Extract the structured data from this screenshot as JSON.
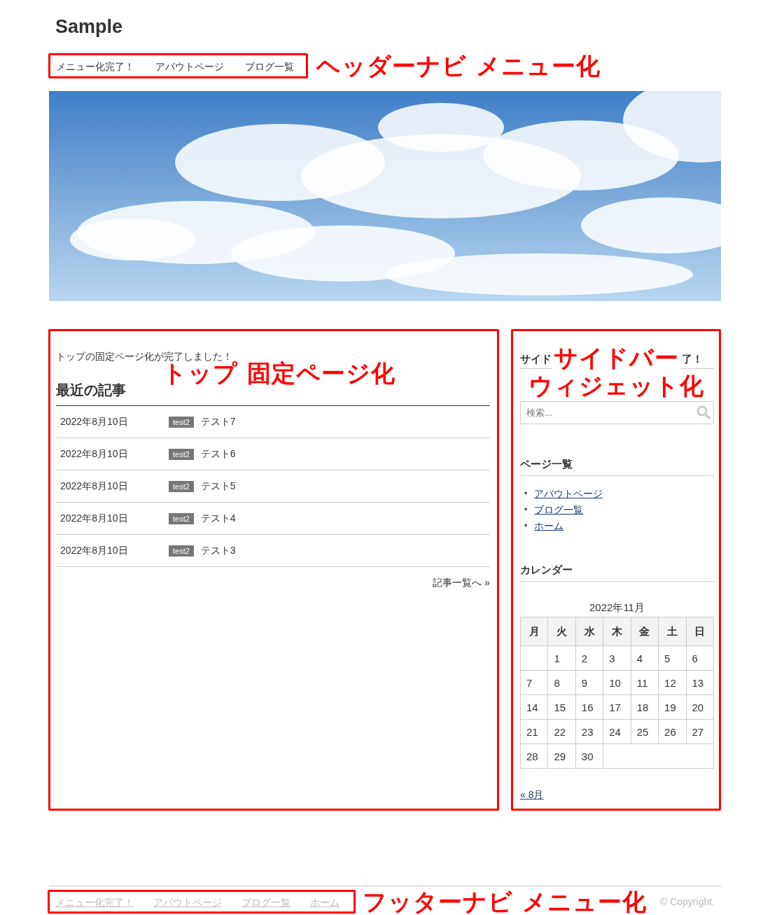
{
  "site_title": "Sample",
  "header_nav": {
    "items": [
      "メニュー化完了！",
      "アバウトページ",
      "ブログ一覧"
    ],
    "annotation": "ヘッダーナビ メニュー化"
  },
  "main": {
    "intro": "トップの固定ページ化が完了しました！",
    "annotation": "トップ 固定ページ化",
    "heading": "最近の記事",
    "posts": [
      {
        "date": "2022年8月10日",
        "tag": "test2",
        "title": "テスト7"
      },
      {
        "date": "2022年8月10日",
        "tag": "test2",
        "title": "テスト6"
      },
      {
        "date": "2022年8月10日",
        "tag": "test2",
        "title": "テスト5"
      },
      {
        "date": "2022年8月10日",
        "tag": "test2",
        "title": "テスト4"
      },
      {
        "date": "2022年8月10日",
        "tag": "test2",
        "title": "テスト3"
      }
    ],
    "more_link": "記事一覧へ »"
  },
  "sidebar": {
    "widget_title_parts": [
      "サイド",
      "了！"
    ],
    "annotation_lines": [
      "サイドバー",
      "ウィジェット化"
    ],
    "search": {
      "placeholder": "検索..."
    },
    "pages": {
      "title": "ページ一覧",
      "bullet": "•",
      "items": [
        "アバウトページ",
        "ブログ一覧",
        "ホーム"
      ]
    },
    "calendar": {
      "title": "カレンダー",
      "caption": "2022年11月",
      "weekdays": [
        "月",
        "火",
        "水",
        "木",
        "金",
        "土",
        "日"
      ],
      "weeks": [
        [
          "1",
          "2",
          "3",
          "4",
          "5",
          "6"
        ],
        [
          "7",
          "8",
          "9",
          "10",
          "11",
          "12",
          "13"
        ],
        [
          "14",
          "15",
          "16",
          "17",
          "18",
          "19",
          "20"
        ],
        [
          "21",
          "22",
          "23",
          "24",
          "25",
          "26",
          "27"
        ],
        [
          "28",
          "29",
          "30"
        ]
      ],
      "prev_link": "« 8月"
    }
  },
  "footer": {
    "nav": [
      "メニュー化完了！",
      "アバウトページ",
      "ブログ一覧",
      "ホーム"
    ],
    "annotation": "フッターナビ メニュー化",
    "copyright": "© Copyright."
  }
}
